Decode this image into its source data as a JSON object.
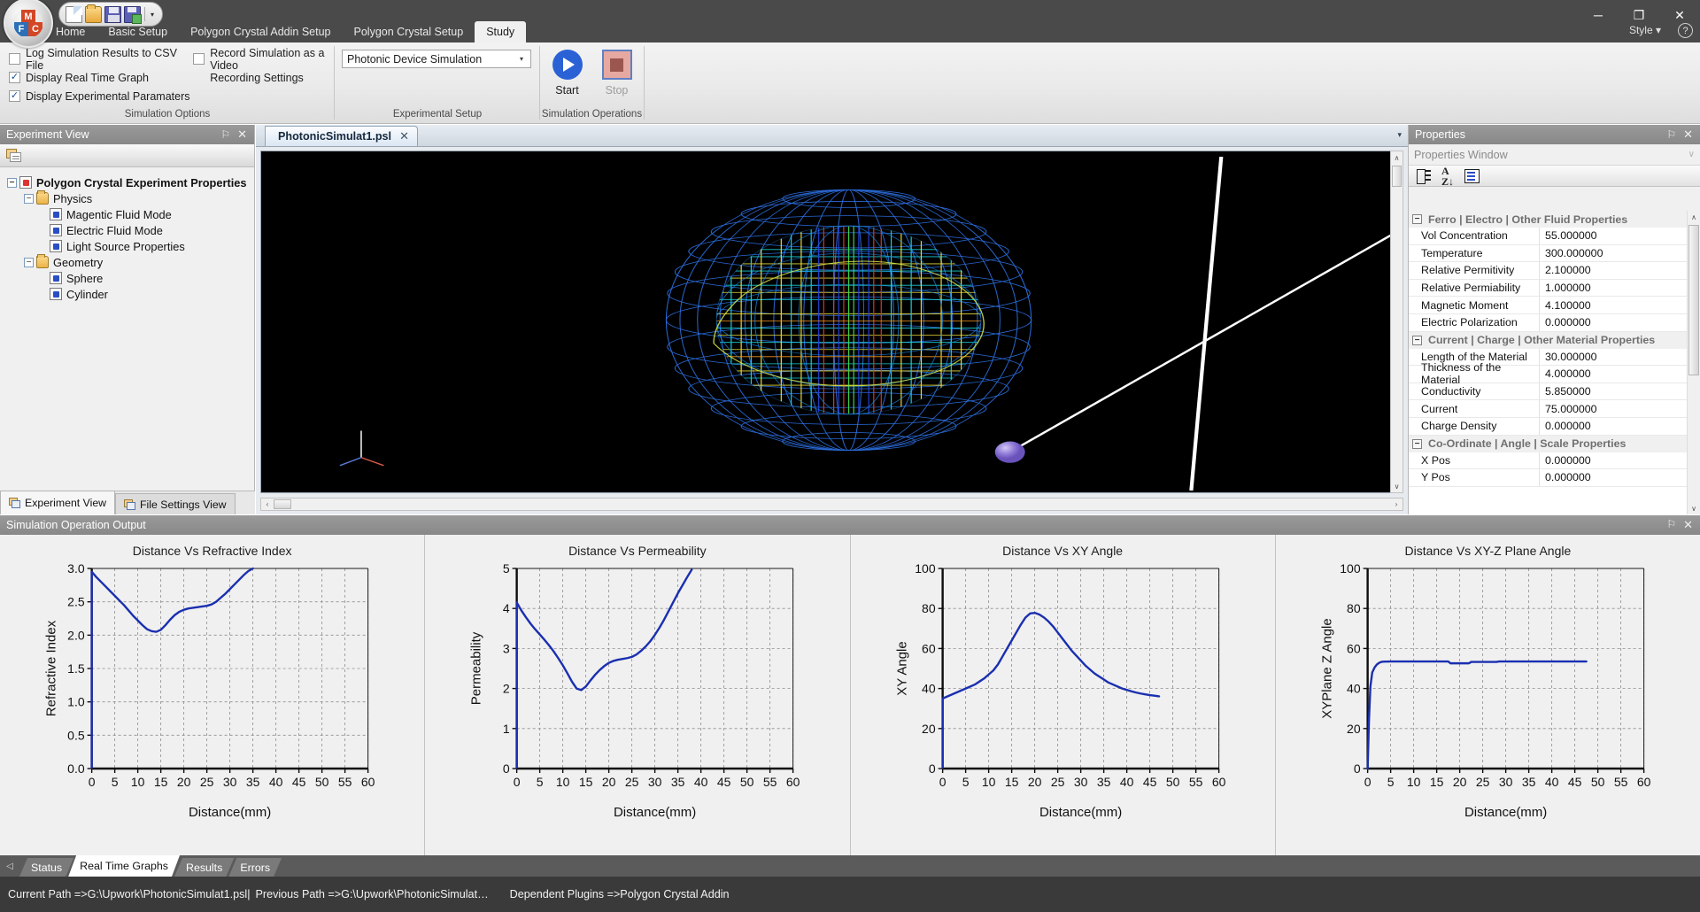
{
  "titlebar": {
    "quick_access": [
      "new-document",
      "open-folder",
      "save",
      "save-as"
    ],
    "overflow_label": "▾",
    "minimize": "─",
    "maximize": "❐",
    "close": "✕"
  },
  "ribbon": {
    "tabs": [
      {
        "label": "Home",
        "active": false
      },
      {
        "label": "Basic Setup",
        "active": false
      },
      {
        "label": "Polygon Crystal Addin Setup",
        "active": false
      },
      {
        "label": "Polygon Crystal Setup",
        "active": false
      },
      {
        "label": "Study",
        "active": true
      }
    ],
    "style_label": "Style",
    "style_arrow": "▾",
    "help_label": "?",
    "groups": [
      {
        "title": "Simulation Options",
        "checkboxes": [
          {
            "label": "Log Simulation Results to CSV File",
            "checked": false
          },
          {
            "label": "Record Simulation as a Video",
            "checked": false
          },
          {
            "label": "Display Real Time Graph",
            "checked": true
          },
          {
            "label": "Display Experimental Paramaters",
            "checked": true
          }
        ],
        "link_label": "Recording Settings"
      },
      {
        "title": "Experimental Setup",
        "combo_value": "Photonic Device Simulation",
        "combo_arrow": "▾"
      },
      {
        "title": "Simulation Operations",
        "buttons": [
          {
            "label": "Start",
            "icon": "play-icon",
            "enabled": true
          },
          {
            "label": "Stop",
            "icon": "stop-icon",
            "enabled": false
          }
        ]
      }
    ]
  },
  "experiment_view": {
    "title": "Experiment View",
    "pin_icon": "⚐",
    "close_icon": "✕",
    "toolbar_icon": "properties-icon",
    "tree": [
      {
        "label": "Polygon Crystal Experiment Properties",
        "level": 0,
        "icon": "experiment-icon",
        "expanded": true,
        "bold": true
      },
      {
        "label": "Physics",
        "level": 1,
        "icon": "folder-icon",
        "expanded": true,
        "bold": false
      },
      {
        "label": "Magentic Fluid Mode",
        "level": 2,
        "icon": "node-icon",
        "expanded": null,
        "bold": false
      },
      {
        "label": "Electric Fluid Mode",
        "level": 2,
        "icon": "node-icon",
        "expanded": null,
        "bold": false
      },
      {
        "label": "Light Source Properties",
        "level": 2,
        "icon": "node-icon",
        "expanded": null,
        "bold": false
      },
      {
        "label": "Geometry",
        "level": 1,
        "icon": "folder-icon",
        "expanded": true,
        "bold": false
      },
      {
        "label": "Sphere",
        "level": 2,
        "icon": "node-icon",
        "expanded": null,
        "bold": false
      },
      {
        "label": "Cylinder",
        "level": 2,
        "icon": "node-icon",
        "expanded": null,
        "bold": false
      }
    ],
    "bottom_tabs": [
      {
        "label": "Experiment View",
        "active": true
      },
      {
        "label": "File Settings View",
        "active": false
      }
    ]
  },
  "document": {
    "tab_label": "PhotonicSimulat1.psl",
    "tab_close": "✕",
    "dropdown_arrow": "▾",
    "scroll_up": "∧",
    "scroll_down": "∨",
    "scroll_left": "‹",
    "scroll_right": "›"
  },
  "properties": {
    "title": "Properties",
    "pin_icon": "⚐",
    "close_icon": "✕",
    "subtitle": "Properties Window",
    "collapse_arrow": "∨",
    "toolbar_icons": [
      "categorized-icon",
      "alphabetical-icon",
      "property-pages-icon"
    ],
    "scroll_up": "∧",
    "scroll_down": "∨",
    "groups": [
      {
        "name": "Ferro | Electro | Other Fluid Properties",
        "expanded": true,
        "rows": [
          {
            "key": "Vol Concentration",
            "value": "55.000000"
          },
          {
            "key": "Temperature",
            "value": "300.000000"
          },
          {
            "key": "Relative Permitivity",
            "value": "2.100000"
          },
          {
            "key": "Relative Permiability",
            "value": "1.000000"
          },
          {
            "key": "Magnetic Moment",
            "value": "4.100000"
          },
          {
            "key": "Electric Polarization",
            "value": "0.000000"
          }
        ]
      },
      {
        "name": "Current | Charge | Other Material Properties",
        "expanded": true,
        "rows": [
          {
            "key": "Length of the Material",
            "value": "30.000000"
          },
          {
            "key": "Thickness of the Material",
            "value": "4.000000"
          },
          {
            "key": "Conductivity",
            "value": "5.850000"
          },
          {
            "key": "Current",
            "value": "75.000000"
          },
          {
            "key": "Charge Density",
            "value": "0.000000"
          }
        ]
      },
      {
        "name": "Co-Ordinate | Angle | Scale Properties",
        "expanded": true,
        "rows": [
          {
            "key": "X Pos",
            "value": "0.000000"
          },
          {
            "key": "Y Pos",
            "value": "0.000000"
          }
        ]
      }
    ]
  },
  "output": {
    "title": "Simulation Operation Output",
    "pin_icon": "⚐",
    "close_icon": "✕",
    "nav_left": "◁",
    "tabs": [
      {
        "label": "Status",
        "active": false
      },
      {
        "label": "Real Time Graphs",
        "active": true
      },
      {
        "label": "Results",
        "active": false
      },
      {
        "label": "Errors",
        "active": false
      }
    ]
  },
  "statusbar": {
    "current_path": "Current Path =>G:\\Upwork\\PhotonicSimulat1.psl|",
    "previous_path": "Previous Path =>G:\\Upwork\\PhotonicSimulat…",
    "dependent_plugins": "Dependent Plugins =>Polygon Crystal Addin"
  },
  "colors": {
    "accent": "#2a62d6",
    "series": "#1a2fb0",
    "titlebar": "#4a4a4a",
    "panel_header": "#8f8f8f",
    "statusbar": "#3a3a3a"
  },
  "chart_data": [
    {
      "type": "line",
      "title": "Distance Vs Refractive Index",
      "xlabel": "Distance(mm)",
      "ylabel": "Refractive Index",
      "xlim": [
        0,
        60
      ],
      "ylim": [
        0.0,
        3.0
      ],
      "xticks": [
        0,
        5,
        10,
        15,
        20,
        25,
        30,
        35,
        40,
        45,
        50,
        55,
        60
      ],
      "yticks": [
        "0.0",
        "0.5",
        "1.0",
        "1.5",
        "2.0",
        "2.5",
        "3.0"
      ],
      "grid": true,
      "legend": "none",
      "x": [
        0,
        1,
        2,
        3,
        4,
        5,
        6,
        7,
        8,
        9,
        10,
        11,
        12,
        13,
        14,
        15,
        16,
        17,
        18,
        19,
        20,
        21,
        22,
        23,
        24,
        25,
        26,
        27,
        28,
        29,
        30,
        31,
        32,
        33,
        34,
        35
      ],
      "y": [
        2.95,
        2.87,
        2.8,
        2.73,
        2.66,
        2.59,
        2.52,
        2.45,
        2.37,
        2.29,
        2.22,
        2.15,
        2.09,
        2.06,
        2.05,
        2.08,
        2.15,
        2.23,
        2.3,
        2.35,
        2.38,
        2.4,
        2.41,
        2.42,
        2.43,
        2.44,
        2.46,
        2.5,
        2.56,
        2.62,
        2.69,
        2.76,
        2.83,
        2.9,
        2.96,
        3.0
      ]
    },
    {
      "type": "line",
      "title": "Distance Vs Permeability",
      "xlabel": "Distance(mm)",
      "ylabel": "Permeability",
      "xlim": [
        0,
        60
      ],
      "ylim": [
        0,
        5
      ],
      "xticks": [
        0,
        5,
        10,
        15,
        20,
        25,
        30,
        35,
        40,
        45,
        50,
        55,
        60
      ],
      "yticks": [
        "0",
        "1",
        "2",
        "3",
        "4",
        "5"
      ],
      "grid": true,
      "legend": "none",
      "x": [
        0,
        1,
        2,
        3,
        4,
        5,
        6,
        7,
        8,
        9,
        10,
        11,
        12,
        13,
        14,
        15,
        16,
        17,
        18,
        19,
        20,
        21,
        22,
        23,
        24,
        25,
        26,
        27,
        28,
        29,
        30,
        31,
        32,
        33,
        34,
        35,
        36,
        37,
        38
      ],
      "y": [
        4.15,
        3.95,
        3.78,
        3.62,
        3.48,
        3.35,
        3.22,
        3.08,
        2.93,
        2.76,
        2.58,
        2.38,
        2.17,
        2.0,
        1.96,
        2.05,
        2.2,
        2.34,
        2.46,
        2.56,
        2.64,
        2.69,
        2.72,
        2.74,
        2.76,
        2.79,
        2.85,
        2.94,
        3.05,
        3.18,
        3.34,
        3.52,
        3.72,
        3.94,
        4.16,
        4.38,
        4.58,
        4.78,
        4.97
      ]
    },
    {
      "type": "line",
      "title": "Distance Vs XY Angle",
      "xlabel": "Distance(mm)",
      "ylabel": "XY Angle",
      "xlim": [
        0,
        60
      ],
      "ylim": [
        0,
        100
      ],
      "xticks": [
        0,
        5,
        10,
        15,
        20,
        25,
        30,
        35,
        40,
        45,
        50,
        55,
        60
      ],
      "yticks": [
        "0",
        "20",
        "40",
        "60",
        "80",
        "100"
      ],
      "grid": true,
      "legend": "none",
      "x": [
        0,
        1,
        2,
        3,
        4,
        5,
        6,
        7,
        8,
        9,
        10,
        11,
        12,
        13,
        14,
        15,
        16,
        17,
        18,
        19,
        20,
        21,
        22,
        23,
        24,
        25,
        26,
        27,
        28,
        29,
        30,
        31,
        32,
        33,
        34,
        35,
        36,
        37,
        38,
        39,
        40,
        41,
        42,
        43,
        44,
        45,
        46,
        47
      ],
      "y": [
        35,
        36,
        37,
        38,
        39,
        40,
        41,
        42,
        43.5,
        45,
        47,
        49,
        52,
        56,
        60,
        64,
        68,
        72,
        75.5,
        77.5,
        77.8,
        77,
        75.5,
        73.5,
        71,
        68,
        65,
        62,
        59,
        56.5,
        54,
        51.5,
        49.5,
        47.5,
        46,
        44.5,
        43,
        42,
        41,
        40,
        39.3,
        38.6,
        38,
        37.5,
        37.1,
        36.7,
        36.4,
        36.1
      ]
    },
    {
      "type": "line",
      "title": "Distance Vs XY-Z Plane Angle",
      "xlabel": "Distance(mm)",
      "ylabel": "XYPlane Z Angle",
      "xlim": [
        0,
        60
      ],
      "ylim": [
        0,
        100
      ],
      "xticks": [
        0,
        5,
        10,
        15,
        20,
        25,
        30,
        35,
        40,
        45,
        50,
        55,
        60
      ],
      "yticks": [
        "0",
        "20",
        "40",
        "60",
        "80",
        "100"
      ],
      "grid": true,
      "legend": "none",
      "x": [
        0,
        0.3,
        0.6,
        1.0,
        1.5,
        2.0,
        2.6,
        3.2,
        5,
        8,
        12,
        15,
        17.5,
        18,
        22,
        22.5,
        28,
        28.5,
        34,
        40,
        45,
        47.5
      ],
      "y": [
        0,
        25,
        41,
        48,
        50.5,
        52,
        53,
        53.4,
        53.5,
        53.5,
        53.5,
        53.5,
        53.5,
        52.6,
        52.6,
        53.3,
        53.3,
        53.5,
        53.5,
        53.5,
        53.5,
        53.5
      ]
    }
  ]
}
